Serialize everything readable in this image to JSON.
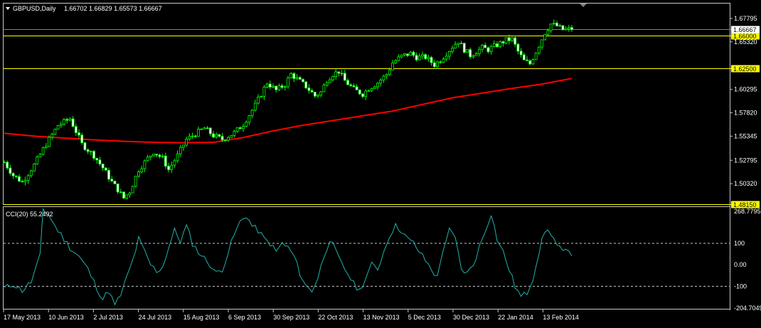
{
  "header": {
    "symbol_label": "GBPUSD,Daily",
    "ohlc": "1.66702 1.66829 1.65573 1.66667",
    "menu_icon": "triangle-down-icon"
  },
  "colors": {
    "background": "#000000",
    "frame": "#c8c8c8",
    "candle": "#00ff00",
    "ma": "#ff0000",
    "level": "#ffff00",
    "cci": "#20b2aa",
    "text": "#ffffff"
  },
  "chart_data": [
    {
      "type": "candlestick",
      "title": "GBPUSD,Daily",
      "ylim": [
        1.4815,
        1.6937
      ],
      "yticks": [
        1.67795,
        1.6532,
        1.60295,
        1.5782,
        1.55345,
        1.52795,
        1.5032
      ],
      "yticks_partial": [
        "1.65320",
        "1.67795"
      ],
      "levels": [
        {
          "value": 1.66,
          "label": "1.66000"
        },
        {
          "value": 1.625,
          "label": "1.62500"
        },
        {
          "value": 1.4815,
          "label": "1.48150"
        }
      ],
      "current_price": {
        "value": 1.66667,
        "label": "1.66667"
      },
      "xlabels": [
        "17 May 2013",
        "10 Jun 2013",
        "2 Jul 2013",
        "24 Jul 2013",
        "15 Aug 2013",
        "6 Sep 2013",
        "30 Sep 2013",
        "22 Oct 2013",
        "13 Nov 2013",
        "5 Dec 2013",
        "30 Dec 2013",
        "22 Jan 2014",
        "13 Feb 2014"
      ],
      "start_date": "2013-05-17",
      "end_date": "2014-02-20",
      "close_anchors": [
        [
          0,
          1.526
        ],
        [
          3,
          1.512
        ],
        [
          6,
          1.505
        ],
        [
          10,
          1.523
        ],
        [
          14,
          1.545
        ],
        [
          18,
          1.565
        ],
        [
          22,
          1.572
        ],
        [
          26,
          1.545
        ],
        [
          30,
          1.533
        ],
        [
          33,
          1.52
        ],
        [
          36,
          1.505
        ],
        [
          38,
          1.497
        ],
        [
          40,
          1.488
        ],
        [
          42,
          1.495
        ],
        [
          45,
          1.518
        ],
        [
          48,
          1.53
        ],
        [
          50,
          1.537
        ],
        [
          53,
          1.53
        ],
        [
          55,
          1.518
        ],
        [
          58,
          1.533
        ],
        [
          61,
          1.55
        ],
        [
          64,
          1.556
        ],
        [
          67,
          1.562
        ],
        [
          70,
          1.554
        ],
        [
          73,
          1.55
        ],
        [
          77,
          1.557
        ],
        [
          80,
          1.566
        ],
        [
          84,
          1.586
        ],
        [
          88,
          1.61
        ],
        [
          91,
          1.602
        ],
        [
          94,
          1.608
        ],
        [
          96,
          1.619
        ],
        [
          98,
          1.614
        ],
        [
          101,
          1.606
        ],
        [
          104,
          1.596
        ],
        [
          106,
          1.6
        ],
        [
          108,
          1.613
        ],
        [
          110,
          1.619
        ],
        [
          112,
          1.622
        ],
        [
          114,
          1.612
        ],
        [
          117,
          1.603
        ],
        [
          120,
          1.598
        ],
        [
          122,
          1.604
        ],
        [
          125,
          1.61
        ],
        [
          128,
          1.619
        ],
        [
          130,
          1.631
        ],
        [
          133,
          1.638
        ],
        [
          136,
          1.641
        ],
        [
          138,
          1.637
        ],
        [
          141,
          1.637
        ],
        [
          144,
          1.629
        ],
        [
          146,
          1.634
        ],
        [
          148,
          1.641
        ],
        [
          150,
          1.648
        ],
        [
          152,
          1.654
        ],
        [
          154,
          1.645
        ],
        [
          156,
          1.639
        ],
        [
          158,
          1.643
        ],
        [
          160,
          1.647
        ],
        [
          162,
          1.645
        ],
        [
          165,
          1.65
        ],
        [
          168,
          1.655
        ],
        [
          170,
          1.656
        ],
        [
          172,
          1.643
        ],
        [
          174,
          1.633
        ],
        [
          176,
          1.63
        ],
        [
          178,
          1.643
        ],
        [
          181,
          1.663
        ],
        [
          183,
          1.672
        ],
        [
          185,
          1.67
        ],
        [
          187,
          1.666
        ],
        [
          190,
          1.667
        ]
      ],
      "ma_period_estimate": null,
      "ma_anchors": [
        [
          0,
          1.5565
        ],
        [
          10,
          1.5535
        ],
        [
          20,
          1.5515
        ],
        [
          30,
          1.5495
        ],
        [
          40,
          1.548
        ],
        [
          50,
          1.547
        ],
        [
          60,
          1.5465
        ],
        [
          70,
          1.547
        ],
        [
          80,
          1.552
        ],
        [
          90,
          1.559
        ],
        [
          100,
          1.565
        ],
        [
          110,
          1.57
        ],
        [
          120,
          1.575
        ],
        [
          130,
          1.58
        ],
        [
          140,
          1.587
        ],
        [
          150,
          1.594
        ],
        [
          160,
          1.599
        ],
        [
          170,
          1.604
        ],
        [
          180,
          1.6085
        ],
        [
          190,
          1.6145
        ]
      ]
    },
    {
      "type": "line",
      "title": "CCI(20) 55.2492",
      "ylim": [
        -204.7049,
        268.7795
      ],
      "yticks": [
        268.7795,
        100,
        0,
        -100,
        -204.7049
      ],
      "ytick_labels": [
        "268.7795",
        "100",
        "0.00",
        "-100",
        "-204.7049"
      ],
      "levels": [
        100,
        -100
      ],
      "anchors": [
        [
          0,
          -110
        ],
        [
          3,
          -90
        ],
        [
          6,
          -120
        ],
        [
          9,
          -80
        ],
        [
          12,
          40
        ],
        [
          13,
          260
        ],
        [
          15,
          230
        ],
        [
          17,
          180
        ],
        [
          19,
          140
        ],
        [
          22,
          80
        ],
        [
          25,
          40
        ],
        [
          28,
          -20
        ],
        [
          30,
          -80
        ],
        [
          33,
          -160
        ],
        [
          35,
          -120
        ],
        [
          37,
          -190
        ],
        [
          39,
          -140
        ],
        [
          41,
          -60
        ],
        [
          43,
          20
        ],
        [
          45,
          120
        ],
        [
          47,
          60
        ],
        [
          49,
          0
        ],
        [
          51,
          -30
        ],
        [
          53,
          -10
        ],
        [
          55,
          80
        ],
        [
          57,
          160
        ],
        [
          59,
          110
        ],
        [
          61,
          180
        ],
        [
          63,
          100
        ],
        [
          65,
          60
        ],
        [
          67,
          30
        ],
        [
          69,
          0
        ],
        [
          71,
          -40
        ],
        [
          73,
          -20
        ],
        [
          75,
          60
        ],
        [
          77,
          140
        ],
        [
          79,
          200
        ],
        [
          81,
          230
        ],
        [
          83,
          180
        ],
        [
          85,
          160
        ],
        [
          87,
          120
        ],
        [
          89,
          100
        ],
        [
          91,
          60
        ],
        [
          93,
          100
        ],
        [
          95,
          80
        ],
        [
          97,
          40
        ],
        [
          99,
          -40
        ],
        [
          101,
          -100
        ],
        [
          103,
          -120
        ],
        [
          105,
          -60
        ],
        [
          107,
          40
        ],
        [
          109,
          120
        ],
        [
          111,
          60
        ],
        [
          113,
          0
        ],
        [
          115,
          -40
        ],
        [
          117,
          -90
        ],
        [
          119,
          -120
        ],
        [
          121,
          -60
        ],
        [
          123,
          0
        ],
        [
          125,
          -20
        ],
        [
          127,
          60
        ],
        [
          129,
          140
        ],
        [
          131,
          180
        ],
        [
          133,
          160
        ],
        [
          135,
          120
        ],
        [
          137,
          100
        ],
        [
          139,
          60
        ],
        [
          141,
          20
        ],
        [
          143,
          -20
        ],
        [
          145,
          -60
        ],
        [
          147,
          80
        ],
        [
          149,
          160
        ],
        [
          151,
          120
        ],
        [
          153,
          -20
        ],
        [
          155,
          -40
        ],
        [
          157,
          0
        ],
        [
          159,
          80
        ],
        [
          161,
          160
        ],
        [
          163,
          240
        ],
        [
          165,
          120
        ],
        [
          167,
          60
        ],
        [
          169,
          -20
        ],
        [
          171,
          -100
        ],
        [
          173,
          -150
        ],
        [
          175,
          -130
        ],
        [
          177,
          -60
        ],
        [
          179,
          60
        ],
        [
          181,
          160
        ],
        [
          183,
          150
        ],
        [
          185,
          90
        ],
        [
          187,
          60
        ],
        [
          190,
          55
        ]
      ],
      "cci_label": "CCI(20) 55.2492"
    }
  ]
}
